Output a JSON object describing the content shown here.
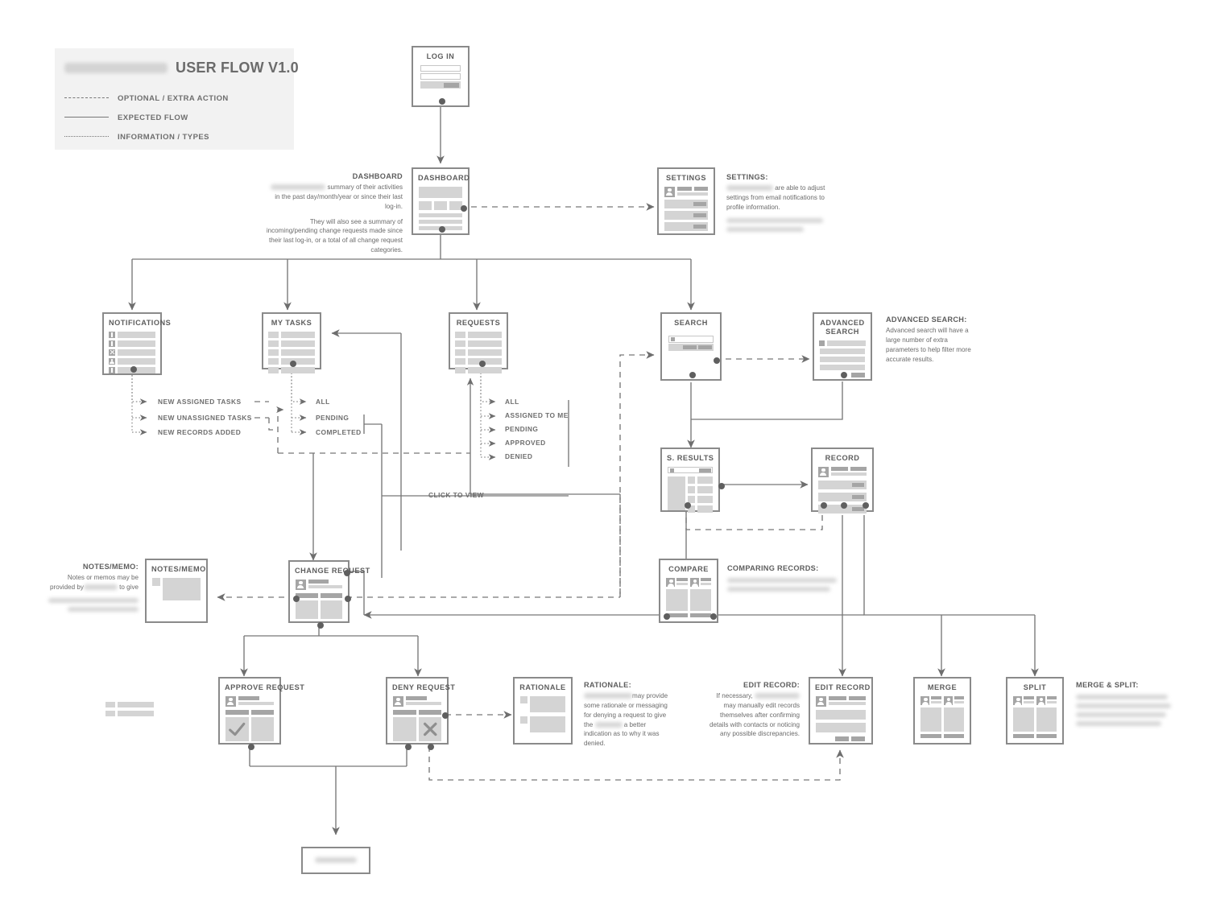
{
  "legend": {
    "title": "USER FLOW V1.0",
    "logo_redacted": true,
    "items": [
      {
        "label": "OPTIONAL / EXTRA ACTION",
        "style": "dashed"
      },
      {
        "label": "EXPECTED FLOW",
        "style": "solid"
      },
      {
        "label": "INFORMATION / TYPES",
        "style": "dotted"
      }
    ]
  },
  "cards": {
    "login": {
      "title": "LOG IN"
    },
    "dashboard": {
      "title": "DASHBOARD"
    },
    "settings": {
      "title": "SETTINGS"
    },
    "notifications": {
      "title": "NOTIFICATIONS"
    },
    "my_tasks": {
      "title": "MY TASKS"
    },
    "requests": {
      "title": "REQUESTS"
    },
    "search": {
      "title": "SEARCH"
    },
    "advanced_search": {
      "title": "ADVANCED SEARCH"
    },
    "s_results": {
      "title": "S. RESULTS"
    },
    "record": {
      "title": "RECORD"
    },
    "notes_memo": {
      "title": "NOTES/MEMO"
    },
    "change_request": {
      "title": "CHANGE REQUEST"
    },
    "compare": {
      "title": "COMPARE"
    },
    "approve_request": {
      "title": "APPROVE REQUEST"
    },
    "deny_request": {
      "title": "DENY REQUEST"
    },
    "rationale": {
      "title": "RATIONALE"
    },
    "edit_record": {
      "title": "EDIT RECORD"
    },
    "merge": {
      "title": "MERGE"
    },
    "split": {
      "title": "SPLIT"
    },
    "end_node": {
      "title": ""
    }
  },
  "annotations": {
    "dashboard": {
      "heading": "DASHBOARD",
      "para1_tail": "summary of their activities in the past day/month/year or since their last log-in.",
      "para2": "They will also see a summary of incoming/pending change requests made since their last log-in, or a total of all change request categories."
    },
    "settings": {
      "heading": "SETTINGS:",
      "para1_tail": "are able to adjust settings from email notifications to profile information.",
      "redacted_lines": 2
    },
    "advanced_search": {
      "heading": "ADVANCED SEARCH:",
      "para1": "Advanced search will have a large number of extra parameters to help filter more accurate results."
    },
    "notes_memo": {
      "heading": "NOTES/MEMO:",
      "para1_lead": "Notes or memos may be provided by",
      "para1_tail": "to give",
      "redacted_lines": 2
    },
    "comparing_records": {
      "heading": "COMPARING RECORDS:",
      "redacted_lines": 2
    },
    "rationale": {
      "heading": "RATIONALE:",
      "para1_a": "may provide some rationale or messaging for denying a request to give the",
      "para1_b": "a better indication as to why it was denied."
    },
    "edit_record": {
      "heading": "EDIT RECORD:",
      "para1_a": "If necessary,",
      "para1_b": "may manually edit records themselves after confirming details with contacts or noticing any possible discrepancies."
    },
    "merge_split": {
      "heading": "MERGE & SPLIT:",
      "redacted_lines": 4
    }
  },
  "flows": {
    "notifications_types": [
      "NEW ASSIGNED TASKS",
      "NEW UNASSIGNED TASKS",
      "NEW RECORDS ADDED"
    ],
    "my_tasks_filters": [
      "ALL",
      "PENDING",
      "COMPLETED"
    ],
    "requests_filters": [
      "ALL",
      "ASSIGNED TO ME",
      "PENDING",
      "APPROVED",
      "DENIED"
    ],
    "click_to_view": "CLICK TO VIEW"
  },
  "colors": {
    "card_border": "#8a8a8a",
    "bar_light": "#d4d4d4",
    "bar_dark": "#a5a5a5",
    "text": "#6b6b6b",
    "line": "#777777",
    "legend_bg": "#f2f2f2",
    "dot": "#5f5f5f"
  }
}
